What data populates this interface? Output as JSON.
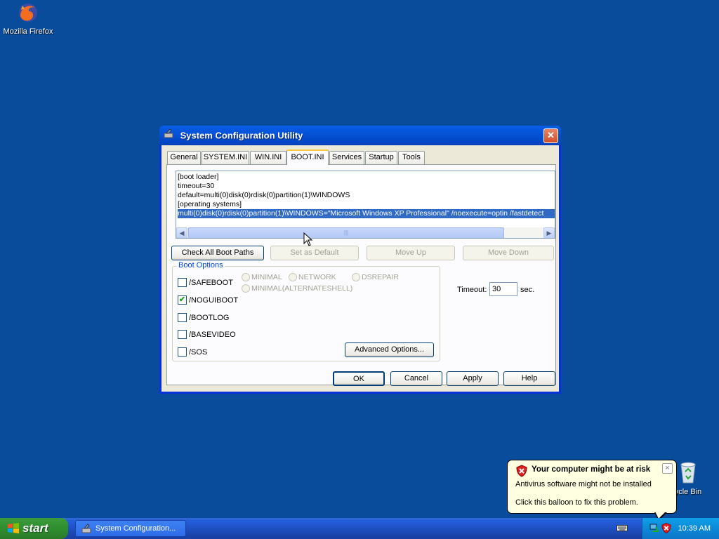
{
  "desktop": {
    "icons": [
      {
        "label": "Mozilla Firefox",
        "icon": "firefox-icon"
      },
      {
        "label": "ycle Bin",
        "icon": "recycle-bin-icon"
      }
    ]
  },
  "window": {
    "title": "System Configuration Utility",
    "tabs": [
      "General",
      "SYSTEM.INI",
      "WIN.INI",
      "BOOT.INI",
      "Services",
      "Startup",
      "Tools"
    ],
    "active_tab": "BOOT.INI",
    "bootini_lines": [
      "[boot loader]",
      "timeout=30",
      "default=multi(0)disk(0)rdisk(0)partition(1)\\WINDOWS",
      "[operating systems]",
      "multi(0)disk(0)rdisk(0)partition(1)\\WINDOWS=\"Microsoft Windows XP Professional\" /noexecute=optin /fastdetect"
    ],
    "selected_line_index": 4,
    "buttons": {
      "check_all": "Check All Boot Paths",
      "set_default": "Set as Default",
      "move_up": "Move Up",
      "move_down": "Move Down",
      "advanced": "Advanced Options...",
      "ok": "OK",
      "cancel": "Cancel",
      "apply": "Apply",
      "help": "Help"
    },
    "boot_options": {
      "legend": "Boot Options",
      "checkboxes": [
        {
          "label": "/SAFEBOOT",
          "checked": false
        },
        {
          "label": "/NOGUIBOOT",
          "checked": true
        },
        {
          "label": "/BOOTLOG",
          "checked": false
        },
        {
          "label": "/BASEVIDEO",
          "checked": false
        },
        {
          "label": "/SOS",
          "checked": false
        }
      ],
      "radios": [
        "MINIMAL",
        "NETWORK",
        "DSREPAIR",
        "MINIMAL(ALTERNATESHELL)"
      ]
    },
    "timeout": {
      "label": "Timeout:",
      "value": "30",
      "unit": "sec."
    }
  },
  "balloon": {
    "title": "Your computer might be at risk",
    "line1": "Antivirus software might not be installed",
    "line2": "Click this balloon to fix this problem.",
    "close": "×"
  },
  "taskbar": {
    "start_label": "start",
    "task_item": "System Configuration...",
    "clock": "10:39 AM"
  }
}
